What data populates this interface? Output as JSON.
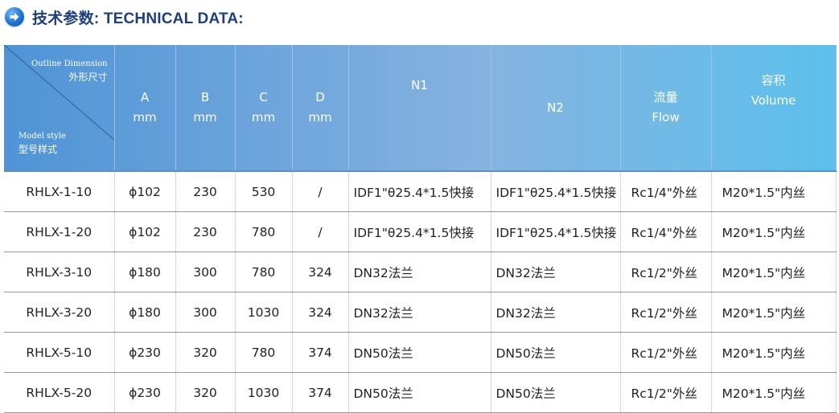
{
  "title": {
    "cn": "技术参数",
    "sep": ": ",
    "en": "TECHNICAL DATA:"
  },
  "table": {
    "corner": {
      "top_en": "Outline Dimension",
      "top_cn": "外形尺寸",
      "bottom_en": "Model style",
      "bottom_cn": "型号样式"
    },
    "headers": [
      {
        "line1": "A",
        "line2": "mm"
      },
      {
        "line1": "B",
        "line2": "mm"
      },
      {
        "line1": "C",
        "line2": "mm"
      },
      {
        "line1": "D",
        "line2": "mm"
      },
      {
        "line1": "N1",
        "line2": ""
      },
      {
        "line1": "N2",
        "line2": ""
      },
      {
        "line1": "流量",
        "line2": "Flow"
      },
      {
        "line1": "容积",
        "line2": "Volume"
      }
    ],
    "rows": [
      [
        "RHLX-1-10",
        "ϕ102",
        "230",
        "530",
        "/",
        "IDF1\"θ25.4*1.5快接",
        "IDF1\"θ25.4*1.5快接",
        "Rc1/4\"外丝",
        "M20*1.5\"内丝"
      ],
      [
        "RHLX-1-20",
        "ϕ102",
        "230",
        "780",
        "/",
        "IDF1\"θ25.4*1.5快接",
        "IDF1\"θ25.4*1.5快接",
        "Rc1/4\"外丝",
        "M20*1.5\"内丝"
      ],
      [
        "RHLX-3-10",
        "ϕ180",
        "300",
        "780",
        "324",
        "DN32法兰",
        "DN32法兰",
        "Rc1/2\"外丝",
        "M20*1.5\"内丝"
      ],
      [
        "RHLX-3-20",
        "ϕ180",
        "300",
        "1030",
        "324",
        "DN32法兰",
        "DN32法兰",
        "Rc1/2\"外丝",
        "M20*1.5\"内丝"
      ],
      [
        "RHLX-5-10",
        "ϕ230",
        "320",
        "780",
        "374",
        "DN50法兰",
        "DN50法兰",
        "Rc1/2\"外丝",
        "M20*1.5\"内丝"
      ],
      [
        "RHLX-5-20",
        "ϕ230",
        "320",
        "1030",
        "374",
        "DN50法兰",
        "DN50法兰",
        "Rc1/2\"外丝",
        "M20*1.5\"内丝"
      ]
    ]
  },
  "colors": {
    "header_left": "#4f94d6",
    "header_mid": "#86b3e0",
    "header_right": "#5cc0ec",
    "title": "#1d3f7a",
    "icon": "#1f73d1"
  }
}
